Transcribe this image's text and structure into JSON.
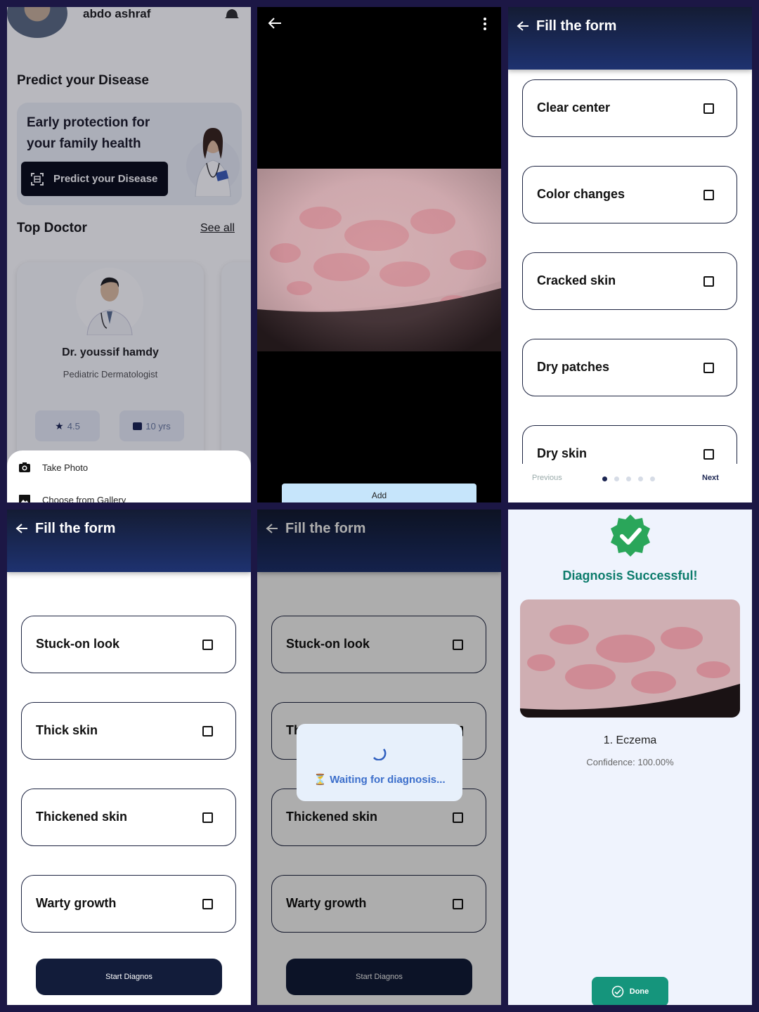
{
  "home": {
    "user_name": "abdo ashraf",
    "section_title": "Predict your Disease",
    "promo_text": "Early protection for your family health",
    "promo_button": "Predict your Disease",
    "top_doctor_title": "Top Doctor",
    "see_all": "See all",
    "doctor": {
      "name": "Dr. youssif hamdy",
      "specialty": "Pediatric Dermatologist",
      "rating": "4.5",
      "experience": "10 yrs"
    },
    "sheet": {
      "take_photo": "Take Photo",
      "choose_gallery": "Choose from Gallery"
    }
  },
  "preview": {
    "add_button": "Add"
  },
  "form": {
    "title": "Fill the form",
    "page1_options": [
      "Clear center",
      "Color changes",
      "Cracked skin",
      "Dry patches",
      "Dry skin"
    ],
    "previous": "Previous",
    "next": "Next",
    "page_index": 1,
    "page_count": 5,
    "last_options": [
      "Stuck-on look",
      "Thick skin",
      "Thickened skin",
      "Warty growth"
    ],
    "start_button": "Start Diagnos"
  },
  "loading": {
    "message": "⏳ Waiting for diagnosis..."
  },
  "result": {
    "title": "Diagnosis Successful!",
    "diagnosis": "1. Eczema",
    "confidence": "Confidence: 100.00%",
    "done_button": "Done"
  },
  "colors": {
    "header_dark": "#141c34",
    "accent_teal": "#15957c",
    "success_green": "#2aa65a"
  }
}
